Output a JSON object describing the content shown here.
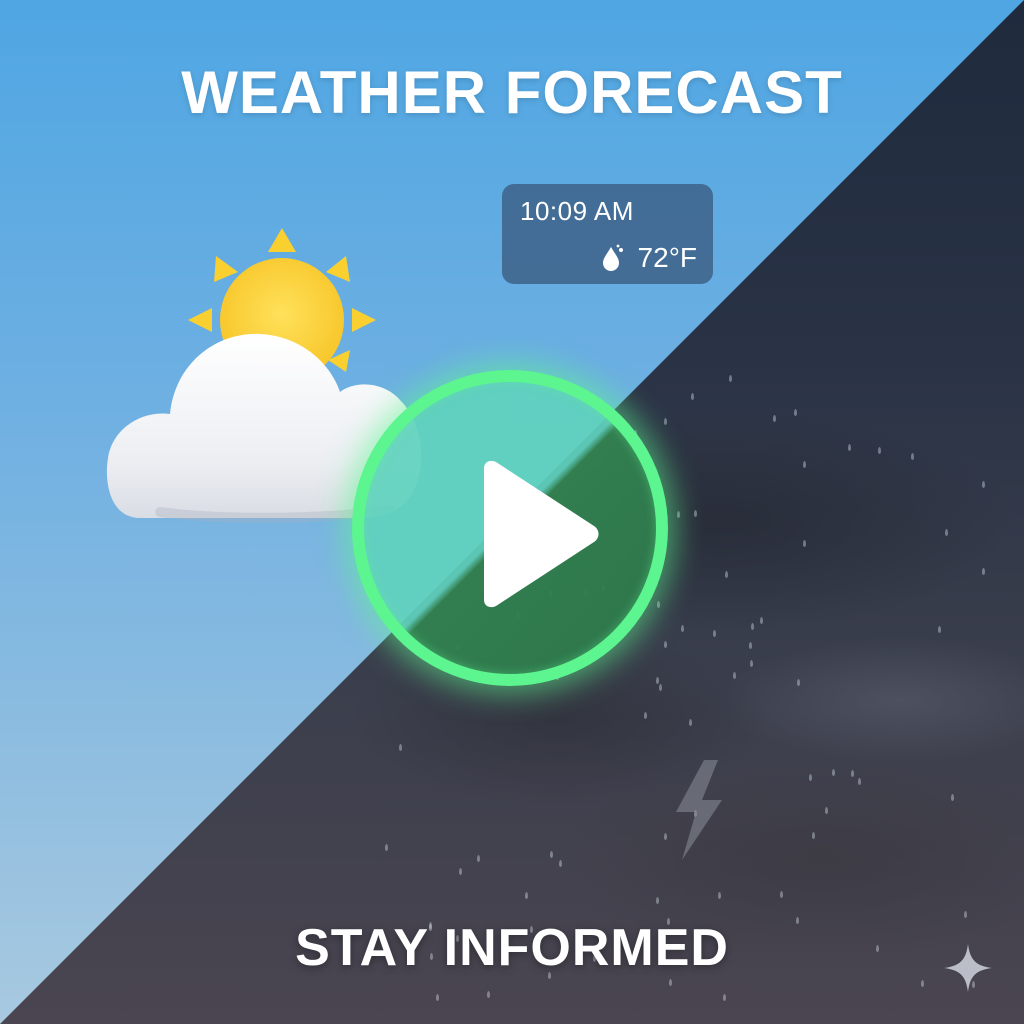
{
  "header": {
    "title": "WEATHER FORECAST"
  },
  "info_card": {
    "time": "10:09 AM",
    "temperature": "72°F",
    "icon": "humidity-drop-icon"
  },
  "hero": {
    "icon": "partly-sunny-icon",
    "play_icon": "play-icon",
    "storm_icon": "lightning-icon"
  },
  "footer": {
    "tagline": "STAY INFORMED",
    "corner_icon": "sparkle-icon"
  },
  "colors": {
    "day_sky": "#4fa6e3",
    "night_sky": "#2a3346",
    "accent_green": "#5cf58f",
    "sun": "#fcd535",
    "text": "#ffffff"
  }
}
